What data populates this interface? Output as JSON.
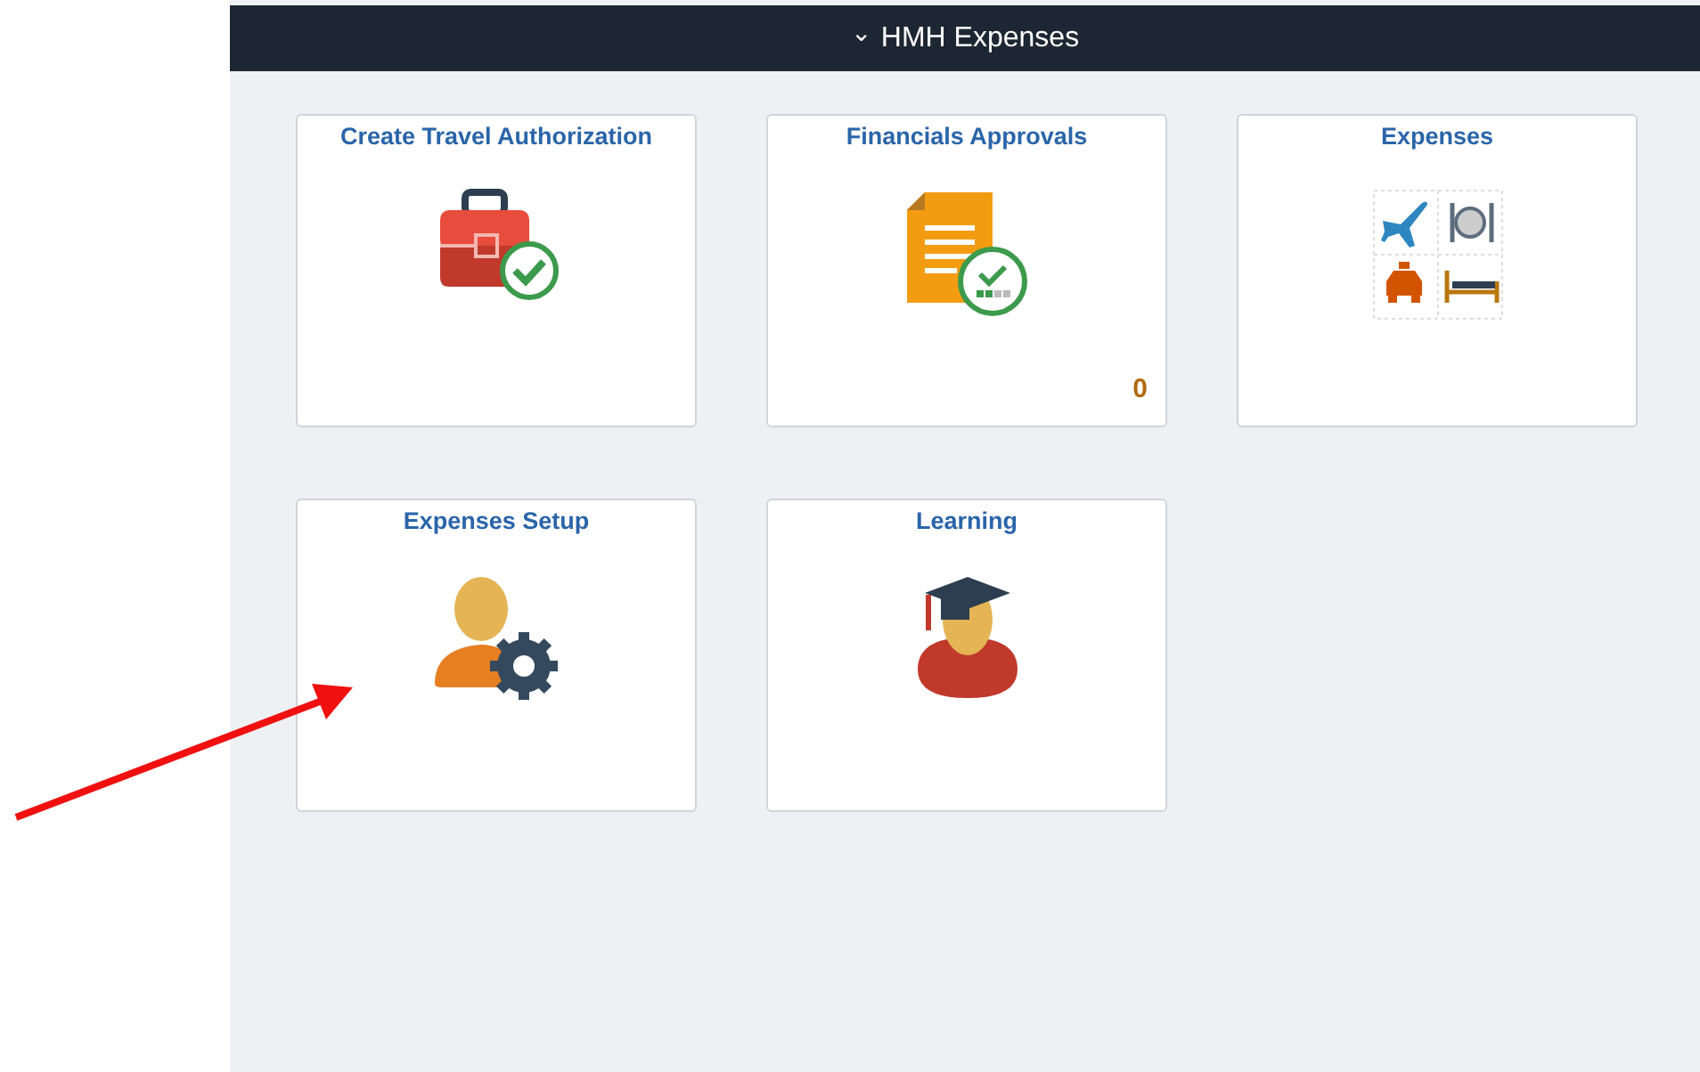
{
  "header": {
    "title": "HMH Expenses",
    "chevron": "⌄"
  },
  "tiles": [
    {
      "title": "Create Travel Authorization",
      "kind": "briefcase"
    },
    {
      "title": "Financials Approvals",
      "kind": "document",
      "badge": "0"
    },
    {
      "title": "Expenses",
      "kind": "expenses"
    },
    {
      "title": "Expenses Setup",
      "kind": "person-gear"
    },
    {
      "title": "Learning",
      "kind": "graduate"
    }
  ]
}
